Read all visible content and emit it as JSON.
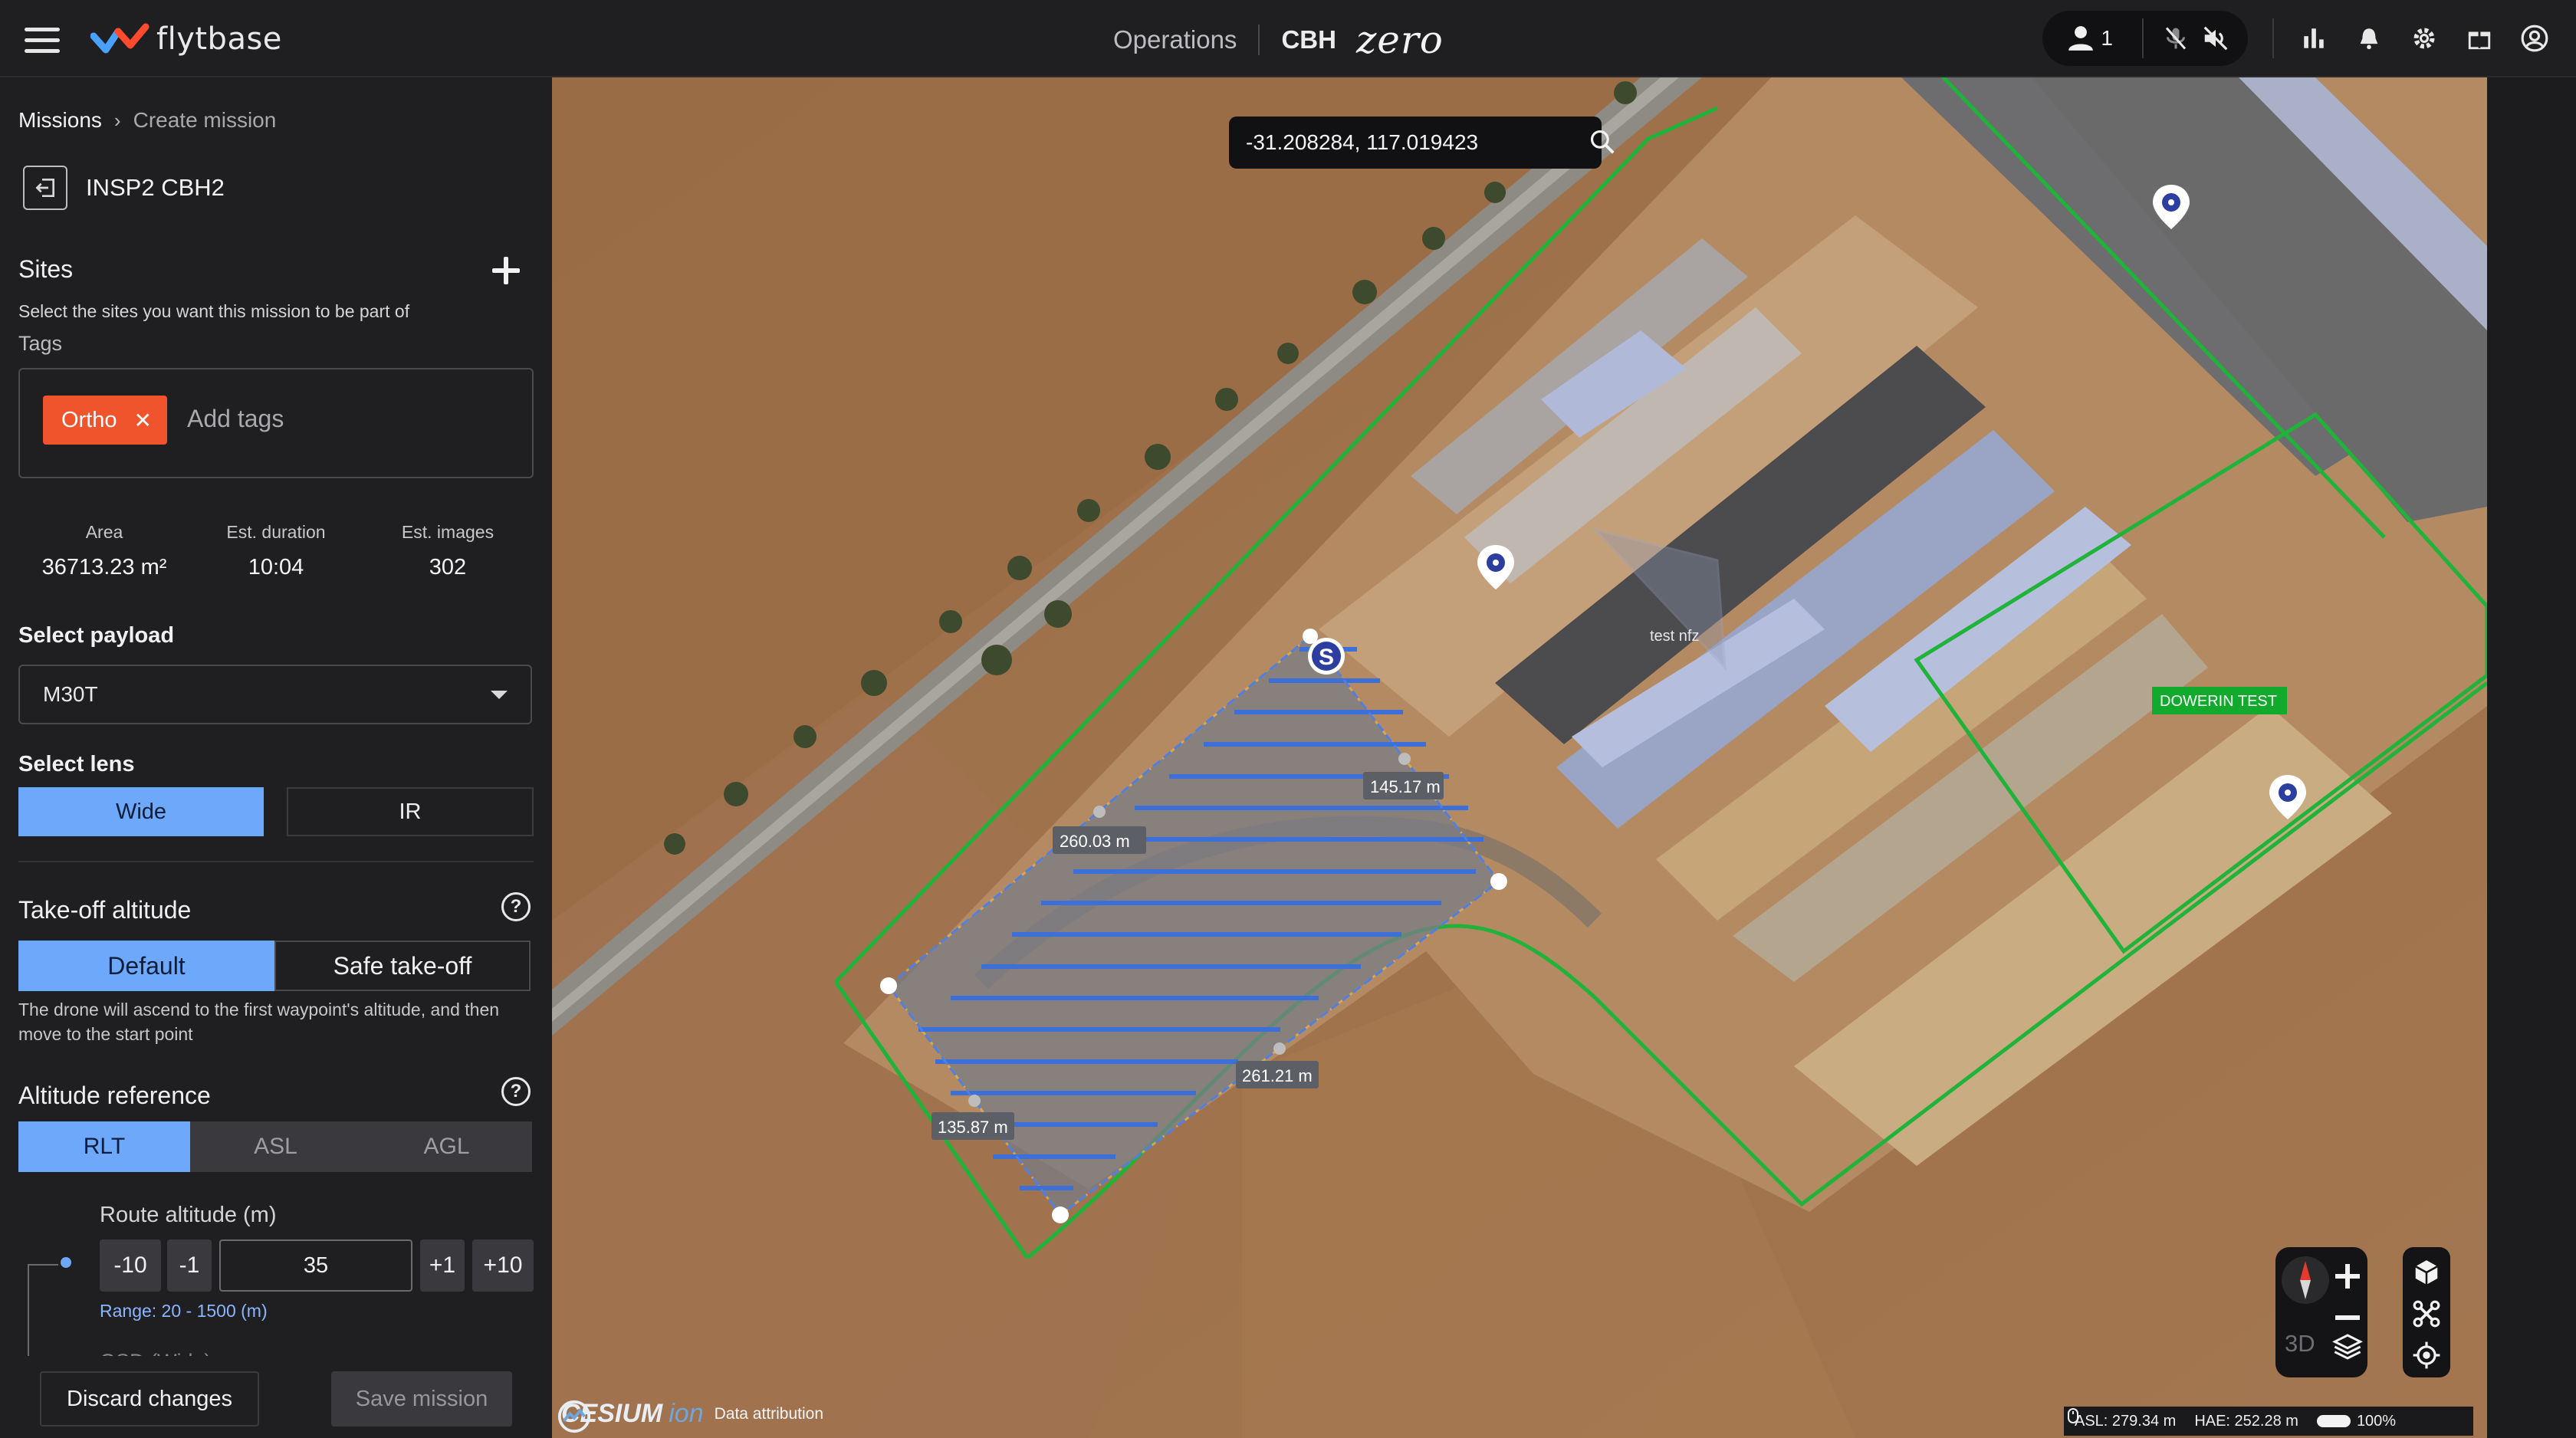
{
  "topbar": {
    "brand": "flytbase",
    "nav_operations": "Operations",
    "site_code": "CBH",
    "product": "zero",
    "user_count": "1"
  },
  "sidebar": {
    "breadcrumb_root": "Missions",
    "breadcrumb_current": "Create mission",
    "mission_name": "INSP2 CBH2",
    "sites_title": "Sites",
    "sites_subtitle": "Select the sites you want this mission to be part of",
    "tags_label": "Tags",
    "tags": [
      "Ortho"
    ],
    "tags_placeholder": "Add tags",
    "stats": [
      {
        "label": "Area",
        "value": "36713.23 m²"
      },
      {
        "label": "Est. duration",
        "value": "10:04"
      },
      {
        "label": "Est. images",
        "value": "302"
      }
    ],
    "payload_label": "Select payload",
    "payload_value": "M30T",
    "lens_label": "Select lens",
    "lens_options": [
      "Wide",
      "IR"
    ],
    "lens_selected": "Wide",
    "takeoff_title": "Take-off altitude",
    "takeoff_options": [
      "Default",
      "Safe take-off"
    ],
    "takeoff_selected": "Default",
    "takeoff_desc": "The drone will ascend to the first waypoint's altitude, and then move to the start point",
    "altref_title": "Altitude reference",
    "altref_options": [
      "RLT",
      "ASL",
      "AGL"
    ],
    "altref_selected": "RLT",
    "route_altitude_label": "Route altitude (m)",
    "route_altitude_steps": [
      "-10",
      "-1",
      "+1",
      "+10"
    ],
    "route_altitude_value": "35",
    "route_altitude_range": "Range: 20 - 1500 (m)",
    "cutoff_label": "GSD (Wide)",
    "discard_label": "Discard changes",
    "save_label": "Save mission"
  },
  "map": {
    "search_value": "-31.208284, 117.019423",
    "start_marker": "S",
    "edge_labels": [
      "260.03 m",
      "145.17 m",
      "261.21 m",
      "135.87 m"
    ],
    "nfz_label": "test nfz",
    "site_label": "DOWERIN TEST",
    "view_mode": "3D",
    "cesium_brand": "CESIUM",
    "cesium_ion": "ion",
    "attribution": "Data attribution",
    "asl": "ASL: 279.34 m",
    "hae": "HAE: 252.28 m",
    "battery": "100%"
  },
  "colors": {
    "accent": "#6ea8fb",
    "tag": "#f0542c",
    "geofence": "#1fb33a",
    "survey": "#3d6fd8"
  }
}
